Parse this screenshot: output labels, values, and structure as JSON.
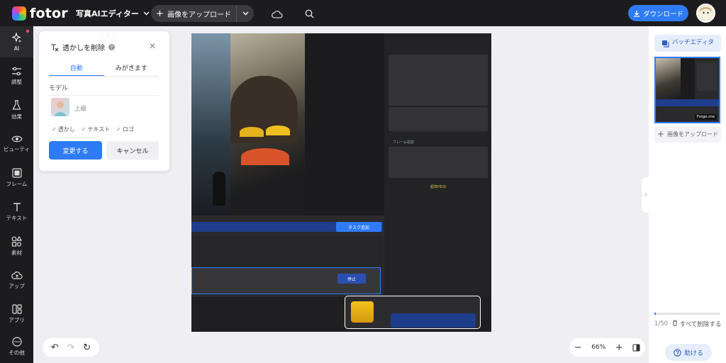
{
  "app": {
    "logo_text": "fotor",
    "editor_switch": "写真AIエディター"
  },
  "header": {
    "upload_label": "画像をアップロード",
    "download_label": "ダウンロード"
  },
  "nav": {
    "items": [
      {
        "label": "AI",
        "icon": "sparkle-icon"
      },
      {
        "label": "調整",
        "icon": "sliders-icon"
      },
      {
        "label": "効果",
        "icon": "flask-icon"
      },
      {
        "label": "ビューティ",
        "icon": "eye-icon"
      },
      {
        "label": "フレーム",
        "icon": "frame-icon"
      },
      {
        "label": "テキスト",
        "icon": "text-icon"
      },
      {
        "label": "素材",
        "icon": "shapes-icon"
      },
      {
        "label": "アップ",
        "icon": "cloud-upload-icon"
      },
      {
        "label": "アプリ",
        "icon": "apps-icon"
      },
      {
        "label": "その他",
        "icon": "more-icon"
      }
    ]
  },
  "panel": {
    "title": "透かしを削除",
    "tabs": [
      "自動",
      "みがきます"
    ],
    "model_label": "モデル",
    "model_name": "上級",
    "checks": [
      "透かし",
      "テキスト",
      "ロゴ"
    ],
    "apply_label": "変更する",
    "cancel_label": "キャンセル"
  },
  "canvas": {
    "texts": {
      "blue_button": "タスク追加",
      "stop_button": "停止",
      "layer_label": "フレーム追加",
      "hd_label": "超高HDの"
    }
  },
  "rightpanel": {
    "batch_label": "バッチエディタ",
    "thumb_tag": "Folge.me",
    "upload_more_label": "画像をアップロード",
    "count": "1/50",
    "count_progress": 0.02,
    "delete_all": "すべて削除する",
    "help_label": "助ける"
  },
  "zoom": {
    "value": "66%"
  }
}
